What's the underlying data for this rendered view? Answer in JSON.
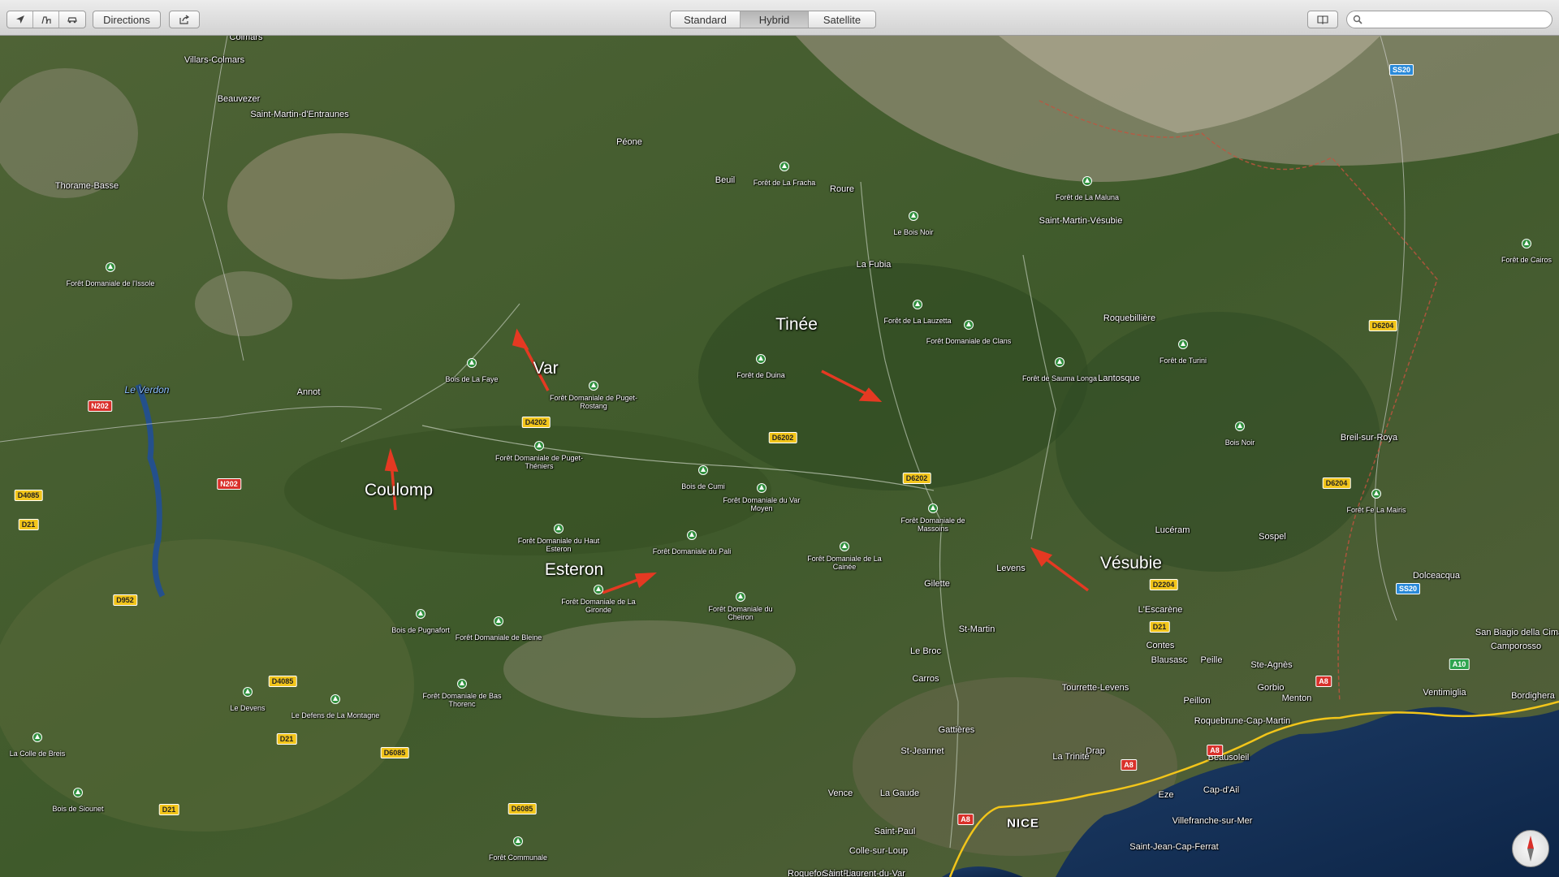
{
  "toolbar": {
    "directions_label": "Directions",
    "map_modes": [
      "Standard",
      "Hybrid",
      "Satellite"
    ],
    "active_mode": "Hybrid",
    "search_placeholder": ""
  },
  "map": {
    "water_labels": [
      {
        "text": "Le Verdon"
      }
    ],
    "city_labels": [
      {
        "text": "NICE"
      }
    ],
    "places": [
      {
        "text": "Colmars"
      },
      {
        "text": "Villars-Colmars"
      },
      {
        "text": "Beauvezer"
      },
      {
        "text": "Saint-Martin-d'Entraunes"
      },
      {
        "text": "Thorame-Basse"
      },
      {
        "text": "Péone"
      },
      {
        "text": "Beuil"
      },
      {
        "text": "Roure"
      },
      {
        "text": "Saint-Martin-Vésubie"
      },
      {
        "text": "La Fubia"
      },
      {
        "text": "Roquebillière"
      },
      {
        "text": "Lantosque"
      },
      {
        "text": "Annot"
      },
      {
        "text": "Breil-sur-Roya"
      },
      {
        "text": "Lucéram"
      },
      {
        "text": "Sospel"
      },
      {
        "text": "Gilette"
      },
      {
        "text": "Levens"
      },
      {
        "text": "L'Escarène"
      },
      {
        "text": "Dolceacqua"
      },
      {
        "text": "St-Martin"
      },
      {
        "text": "Le Broc"
      },
      {
        "text": "Contes"
      },
      {
        "text": "Blausasc"
      },
      {
        "text": "Peille"
      },
      {
        "text": "Ste-Agnès"
      },
      {
        "text": "San Biagio della Cima"
      },
      {
        "text": "Camporosso"
      },
      {
        "text": "Carros"
      },
      {
        "text": "Tourrette-Levens"
      },
      {
        "text": "Gorbio"
      },
      {
        "text": "Menton"
      },
      {
        "text": "Ventimiglia"
      },
      {
        "text": "Bordighera"
      },
      {
        "text": "Peillon"
      },
      {
        "text": "Roquebrune-Cap-Martin"
      },
      {
        "text": "Gattières"
      },
      {
        "text": "Drap"
      },
      {
        "text": "St-Jeannet"
      },
      {
        "text": "La Trinité"
      },
      {
        "text": "Beausoleil"
      },
      {
        "text": "Vence"
      },
      {
        "text": "La Gaude"
      },
      {
        "text": "Eze"
      },
      {
        "text": "Cap-d'Ail"
      },
      {
        "text": "Villefranche-sur-Mer"
      },
      {
        "text": "Saint-Paul"
      },
      {
        "text": "Colle-sur-Loup"
      },
      {
        "text": "Saint-Jean-Cap-Ferrat"
      },
      {
        "text": "Roquefort les Pins"
      },
      {
        "text": "Saint-Laurent-du-Var"
      }
    ],
    "forests": [
      {
        "text": "Forêt de La Fracha"
      },
      {
        "text": "Forêt de La Maluna"
      },
      {
        "text": "Le Bois Noir"
      },
      {
        "text": "Forêt de Cairos"
      },
      {
        "text": "Forêt Domaniale de l'Issole"
      },
      {
        "text": "Forêt de La Lauzetta"
      },
      {
        "text": "Forêt Domaniale de Clans"
      },
      {
        "text": "Forêt de Duina"
      },
      {
        "text": "Forêt de Turini"
      },
      {
        "text": "Forêt de Sauma Longa"
      },
      {
        "text": "Bois de La Faye"
      },
      {
        "text": "Forêt Domaniale de Puget-Rostang"
      },
      {
        "text": "Bois Noir"
      },
      {
        "text": "Forêt Domaniale de Puget-Théniers"
      },
      {
        "text": "Forêt Fe La Mairis"
      },
      {
        "text": "Bois de Cumi"
      },
      {
        "text": "Forêt Domaniale du Var Moyen"
      },
      {
        "text": "Forêt Domaniale de Massoins"
      },
      {
        "text": "Forêt Domaniale du Haut Esteron"
      },
      {
        "text": "Forêt Domaniale du Pali"
      },
      {
        "text": "Forêt Domaniale de La Cainée"
      },
      {
        "text": "Forêt Domaniale de La Gironde"
      },
      {
        "text": "Forêt Domaniale du Cheiron"
      },
      {
        "text": "Bois de Pugnafort"
      },
      {
        "text": "Forêt Domaniale de Bleine"
      },
      {
        "text": "Forêt Domaniale de Bas Thorenc"
      },
      {
        "text": "Le Devens"
      },
      {
        "text": "Le Defens de La Montagne"
      },
      {
        "text": "La Colle de Breis"
      },
      {
        "text": "Bois de Siounet"
      },
      {
        "text": "Forêt Communale"
      }
    ],
    "road_shields": [
      {
        "text": "SS20",
        "color": "blue"
      },
      {
        "text": "D6204",
        "color": "yellow"
      },
      {
        "text": "N202",
        "color": "red"
      },
      {
        "text": "D4202",
        "color": "yellow"
      },
      {
        "text": "D6202",
        "color": "yellow"
      },
      {
        "text": "D6202",
        "color": "yellow"
      },
      {
        "text": "N202",
        "color": "red"
      },
      {
        "text": "D4085",
        "color": "yellow"
      },
      {
        "text": "D21",
        "color": "yellow"
      },
      {
        "text": "D6204",
        "color": "yellow"
      },
      {
        "text": "D2204",
        "color": "yellow"
      },
      {
        "text": "SS20",
        "color": "blue"
      },
      {
        "text": "D952",
        "color": "yellow"
      },
      {
        "text": "D21",
        "color": "yellow"
      },
      {
        "text": "A10",
        "color": "green"
      },
      {
        "text": "D4085",
        "color": "yellow"
      },
      {
        "text": "A8",
        "color": "red"
      },
      {
        "text": "D21",
        "color": "yellow"
      },
      {
        "text": "A8",
        "color": "red"
      },
      {
        "text": "D6085",
        "color": "yellow"
      },
      {
        "text": "A8",
        "color": "red"
      },
      {
        "text": "D21",
        "color": "yellow"
      },
      {
        "text": "D6085",
        "color": "yellow"
      },
      {
        "text": "A8",
        "color": "red"
      }
    ],
    "river_annotations": [
      {
        "text": "Var"
      },
      {
        "text": "Tinée"
      },
      {
        "text": "Coulomp"
      },
      {
        "text": "Esteron"
      },
      {
        "text": "Vésubie"
      }
    ]
  },
  "controls": {
    "zoom_out": "−",
    "zoom_in": "+"
  }
}
